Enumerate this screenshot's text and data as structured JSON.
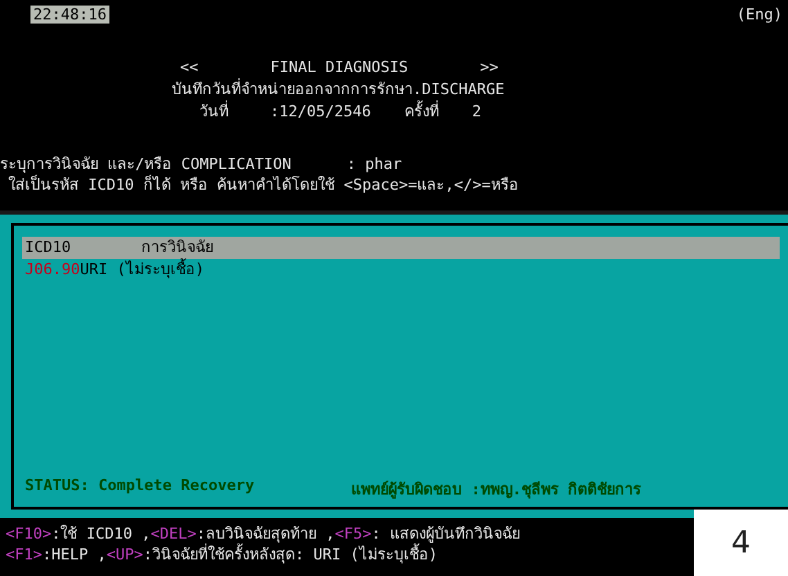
{
  "clock": "22:48:16",
  "language": "(Eng)",
  "header": {
    "prev": "<<",
    "title": "FINAL DIAGNOSIS",
    "next": ">>",
    "subtitle": "บันทึกวันที่จำหน่ายออกจากการรักษา.DISCHARGE",
    "date_label": "วันที่",
    "date_value": ":12/05/2546",
    "visit_label": "ครั้งที่",
    "visit_value": "2"
  },
  "prompt": {
    "label": "ระบุการวินิจฉัย และ/หรือ COMPLICATION",
    "value": ": phar",
    "hint": "ใส่เป็นรหัส ICD10 ก็ได้ หรือ ค้นหาคำได้โดยใช้ <Space>=และ,</>=หรือ"
  },
  "list": {
    "columns": [
      "ICD10",
      "การวินิจฉัย"
    ],
    "rows": [
      {
        "code": "J06.90",
        "diagnosis": "URI (ไม่ระบุเชื้อ)"
      }
    ]
  },
  "status": {
    "text": "STATUS: Complete Recovery",
    "doctor": "แพทย์ผู้รับผิดชอบ :ทพญ.ชุลีพร กิตติชัยการ"
  },
  "footer": [
    [
      {
        "kind": "key",
        "text": "<F10>"
      },
      {
        "kind": "text",
        "text": ":ใช้ ICD10 ,"
      },
      {
        "kind": "key",
        "text": "<DEL>"
      },
      {
        "kind": "text",
        "text": ":ลบวินิจฉัยสุดท้าย ,"
      },
      {
        "kind": "key",
        "text": "<F5>"
      },
      {
        "kind": "text",
        "text": ": แสดงผู้บันทึกวินิจฉัย"
      }
    ],
    [
      {
        "kind": "key",
        "text": "<F1>"
      },
      {
        "kind": "text",
        "text": ":HELP ,"
      },
      {
        "kind": "key",
        "text": "<UP>"
      },
      {
        "kind": "text",
        "text": ":วินิจฉัยที่ใช้ครั้งหลังสุด: URI (ไม่ระบุเชื้อ)"
      }
    ]
  ],
  "page_number": "4"
}
